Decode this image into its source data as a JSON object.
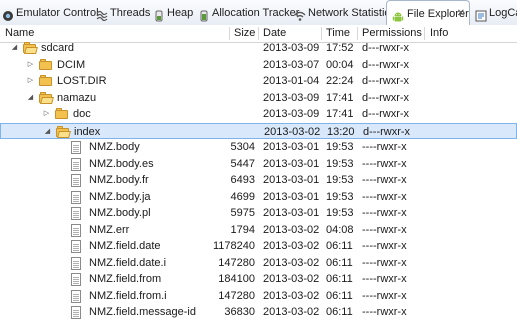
{
  "tabs": [
    {
      "label": "Emulator Control",
      "icon": "emulator-control-icon"
    },
    {
      "label": "Threads",
      "icon": "threads-icon"
    },
    {
      "label": "Heap",
      "icon": "heap-icon"
    },
    {
      "label": "Allocation Tracker",
      "icon": "allocation-tracker-icon"
    },
    {
      "label": "Network Statistics",
      "icon": "network-statistics-icon"
    },
    {
      "label": "File Explorer",
      "icon": "android-icon",
      "active": true,
      "close": "✕"
    },
    {
      "label": "LogCa",
      "icon": "logcat-icon"
    }
  ],
  "columns": {
    "name": "Name",
    "size": "Size",
    "date": "Date",
    "time": "Time",
    "permissions": "Permissions",
    "info": "Info"
  },
  "rows": [
    {
      "name": "sdcard",
      "type": "folder",
      "level": 0,
      "expanded": true,
      "size": "",
      "date": "2013-03-09",
      "time": "17:52",
      "permissions": "d---rwxr-x"
    },
    {
      "name": "DCIM",
      "type": "folder",
      "level": 1,
      "expanded": false,
      "size": "",
      "date": "2013-03-07",
      "time": "00:04",
      "permissions": "d---rwxr-x"
    },
    {
      "name": "LOST.DIR",
      "type": "folder",
      "level": 1,
      "expanded": false,
      "size": "",
      "date": "2013-01-04",
      "time": "22:24",
      "permissions": "d---rwxr-x"
    },
    {
      "name": "namazu",
      "type": "folder",
      "level": 1,
      "expanded": true,
      "size": "",
      "date": "2013-03-09",
      "time": "17:41",
      "permissions": "d---rwxr-x"
    },
    {
      "name": "doc",
      "type": "folder",
      "level": 2,
      "expanded": false,
      "size": "",
      "date": "2013-03-09",
      "time": "17:41",
      "permissions": "d---rwxr-x"
    },
    {
      "name": "index",
      "type": "folder",
      "level": 2,
      "expanded": true,
      "selected": true,
      "size": "",
      "date": "2013-03-02",
      "time": "13:20",
      "permissions": "d---rwxr-x"
    },
    {
      "name": "NMZ.body",
      "type": "file",
      "level": 3,
      "size": "5304",
      "date": "2013-03-01",
      "time": "19:53",
      "permissions": "----rwxr-x"
    },
    {
      "name": "NMZ.body.es",
      "type": "file",
      "level": 3,
      "size": "5447",
      "date": "2013-03-01",
      "time": "19:53",
      "permissions": "----rwxr-x"
    },
    {
      "name": "NMZ.body.fr",
      "type": "file",
      "level": 3,
      "size": "6493",
      "date": "2013-03-01",
      "time": "19:53",
      "permissions": "----rwxr-x"
    },
    {
      "name": "NMZ.body.ja",
      "type": "file",
      "level": 3,
      "size": "4699",
      "date": "2013-03-01",
      "time": "19:53",
      "permissions": "----rwxr-x"
    },
    {
      "name": "NMZ.body.pl",
      "type": "file",
      "level": 3,
      "size": "5975",
      "date": "2013-03-01",
      "time": "19:53",
      "permissions": "----rwxr-x"
    },
    {
      "name": "NMZ.err",
      "type": "file",
      "level": 3,
      "size": "1794",
      "date": "2013-03-02",
      "time": "04:08",
      "permissions": "----rwxr-x"
    },
    {
      "name": "NMZ.field.date",
      "type": "file",
      "level": 3,
      "size": "1178240",
      "date": "2013-03-02",
      "time": "06:11",
      "permissions": "----rwxr-x"
    },
    {
      "name": "NMZ.field.date.i",
      "type": "file",
      "level": 3,
      "size": "147280",
      "date": "2013-03-02",
      "time": "06:11",
      "permissions": "----rwxr-x"
    },
    {
      "name": "NMZ.field.from",
      "type": "file",
      "level": 3,
      "size": "184100",
      "date": "2013-03-02",
      "time": "06:11",
      "permissions": "----rwxr-x"
    },
    {
      "name": "NMZ.field.from.i",
      "type": "file",
      "level": 3,
      "size": "147280",
      "date": "2013-03-02",
      "time": "06:11",
      "permissions": "----rwxr-x"
    },
    {
      "name": "NMZ.field.message-id",
      "type": "file",
      "level": 3,
      "size": "36830",
      "date": "2013-03-02",
      "time": "06:11",
      "permissions": "----rwxr-x"
    }
  ]
}
